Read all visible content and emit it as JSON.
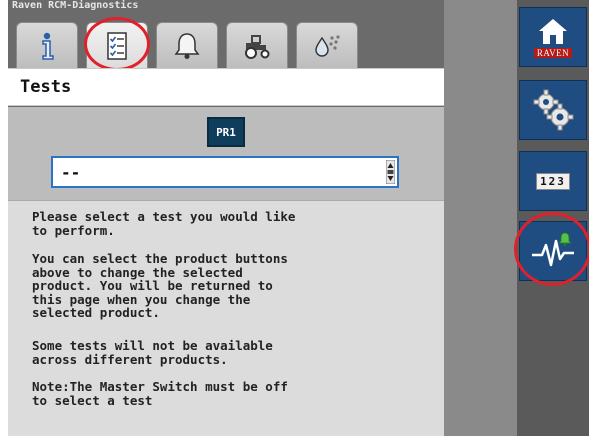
{
  "app": {
    "title": "Raven RCM-Diagnostics"
  },
  "tabs": [
    {
      "id": "info",
      "icon": "info-icon"
    },
    {
      "id": "tests",
      "icon": "checklist-icon",
      "active": true
    },
    {
      "id": "alarms",
      "icon": "bell-icon"
    },
    {
      "id": "machine",
      "icon": "tractor-icon"
    },
    {
      "id": "product",
      "icon": "droplets-icon"
    }
  ],
  "page": {
    "title": "Tests"
  },
  "product": {
    "button_label": "PR1"
  },
  "test_select": {
    "value": "--"
  },
  "instructions": [
    "Please select a test you would like\nto perform.",
    "You can select the product buttons\nabove to change the selected\nproduct. You will be returned to\nthis page when you change the\nselected product.",
    "Some tests will not be available\nacross different products.",
    "Note:The Master Switch must be off\nto select a test"
  ],
  "side": {
    "home_label": "RAVEN",
    "numpad_label": "123"
  },
  "colors": {
    "accent_blue": "#1f4d82",
    "highlight_red": "#e0202a",
    "select_border": "#2b73c7",
    "product_button": "#0f3d5c"
  }
}
